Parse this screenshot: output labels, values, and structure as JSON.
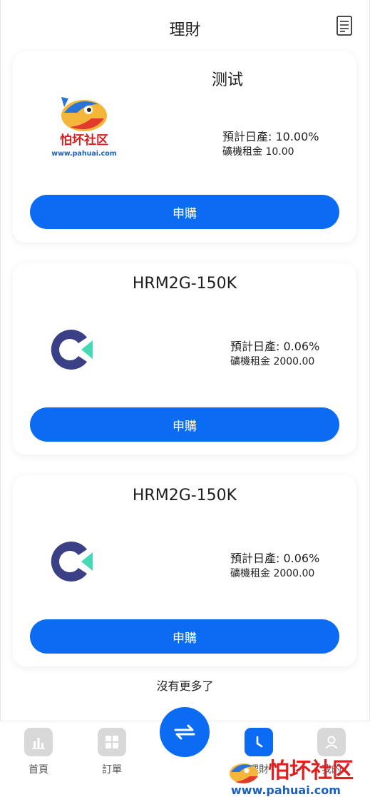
{
  "header": {
    "title": "理財",
    "doc_icon": "document-icon"
  },
  "products": [
    {
      "name": "测试",
      "logo": "pahuai-community-logo",
      "logo_text_main": "怕坏社区",
      "logo_text_url": "www.pahuai.com",
      "daily_rate_label": "預計日產: 10.00%",
      "rent_label": "礦機租金 10.00",
      "button_label": "申購"
    },
    {
      "name": "HRM2G-150K",
      "logo": "c-brand-logo",
      "daily_rate_label": "預計日產: 0.06%",
      "rent_label": "礦機租金 2000.00",
      "button_label": "申購"
    },
    {
      "name": "HRM2G-150K",
      "logo": "c-brand-logo",
      "daily_rate_label": "預計日產: 0.06%",
      "rent_label": "礦機租金 2000.00",
      "button_label": "申購"
    }
  ],
  "footer_note": "沒有更多了",
  "tabbar": {
    "items": [
      {
        "label": "首頁",
        "icon": "bar-chart-icon",
        "active": false
      },
      {
        "label": "訂單",
        "icon": "grid-icon",
        "active": false
      },
      {
        "label": "",
        "icon": "swap-arrows-icon",
        "active": false
      },
      {
        "label": "理財",
        "icon": "clock-icon",
        "active": true
      },
      {
        "label": "我的",
        "icon": "user-icon",
        "active": false
      }
    ]
  },
  "watermark": {
    "text": "怕坏社区",
    "url": "www.pahuai.com"
  },
  "colors": {
    "primary": "#0b6cf3",
    "logo_dark": "#3b3f86",
    "logo_teal": "#46d9b4",
    "watermark_red": "#e02020"
  }
}
